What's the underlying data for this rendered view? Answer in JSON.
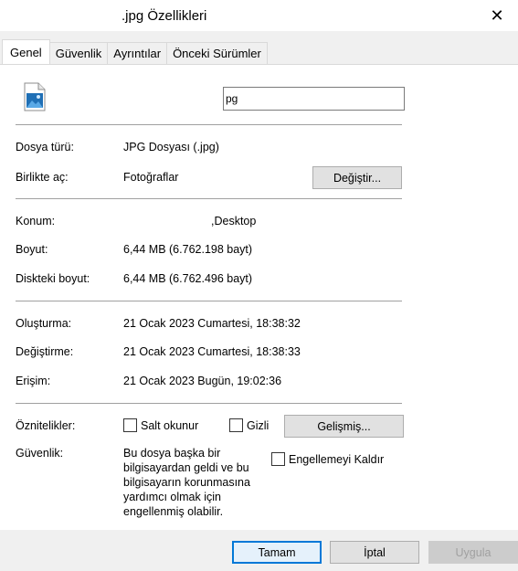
{
  "window": {
    "title": ".jpg Özellikleri",
    "close_glyph": "✕"
  },
  "tabs": [
    {
      "label": "Genel"
    },
    {
      "label": "Güvenlik"
    },
    {
      "label": "Ayrıntılar"
    },
    {
      "label": "Önceki Sürümler"
    }
  ],
  "general": {
    "file_name_value": "pg",
    "file_type_label": "Dosya türü:",
    "file_type_value": "JPG Dosyası (.jpg)",
    "opens_with_label": "Birlikte aç:",
    "opens_with_value": "Fotoğraflar",
    "change_button": "Değiştir...",
    "location_label": "Konum:",
    "location_value": ",Desktop",
    "size_label": "Boyut:",
    "size_value": "6,44 MB (6.762.198 bayt)",
    "size_on_disk_label": "Diskteki boyut:",
    "size_on_disk_value": "6,44 MB (6.762.496 bayt)",
    "created_label": "Oluşturma:",
    "created_value": "21 Ocak 2023 Cumartesi, 18:38:32",
    "modified_label": "Değiştirme:",
    "modified_value": "21 Ocak 2023 Cumartesi, 18:38:33",
    "accessed_label": "Erişim:",
    "accessed_value": "21 Ocak 2023 Bugün, 19:02:36",
    "attributes_label": "Öznitelikler:",
    "readonly_label": "Salt okunur",
    "hidden_label": "Gizli",
    "advanced_button": "Gelişmiş...",
    "security_label": "Güvenlik:",
    "security_text": "Bu dosya başka bir bilgisayardan geldi ve bu bilgisayarın korunmasına yardımcı olmak için engellenmiş olabilir.",
    "unblock_label": "Engellemeyi Kaldır"
  },
  "footer": {
    "ok": "Tamam",
    "cancel": "İptal",
    "apply": "Uygula"
  },
  "icons": {
    "file_icon": "image-file-icon",
    "close_icon": "close-icon"
  },
  "colors": {
    "accent": "#0078d7"
  }
}
